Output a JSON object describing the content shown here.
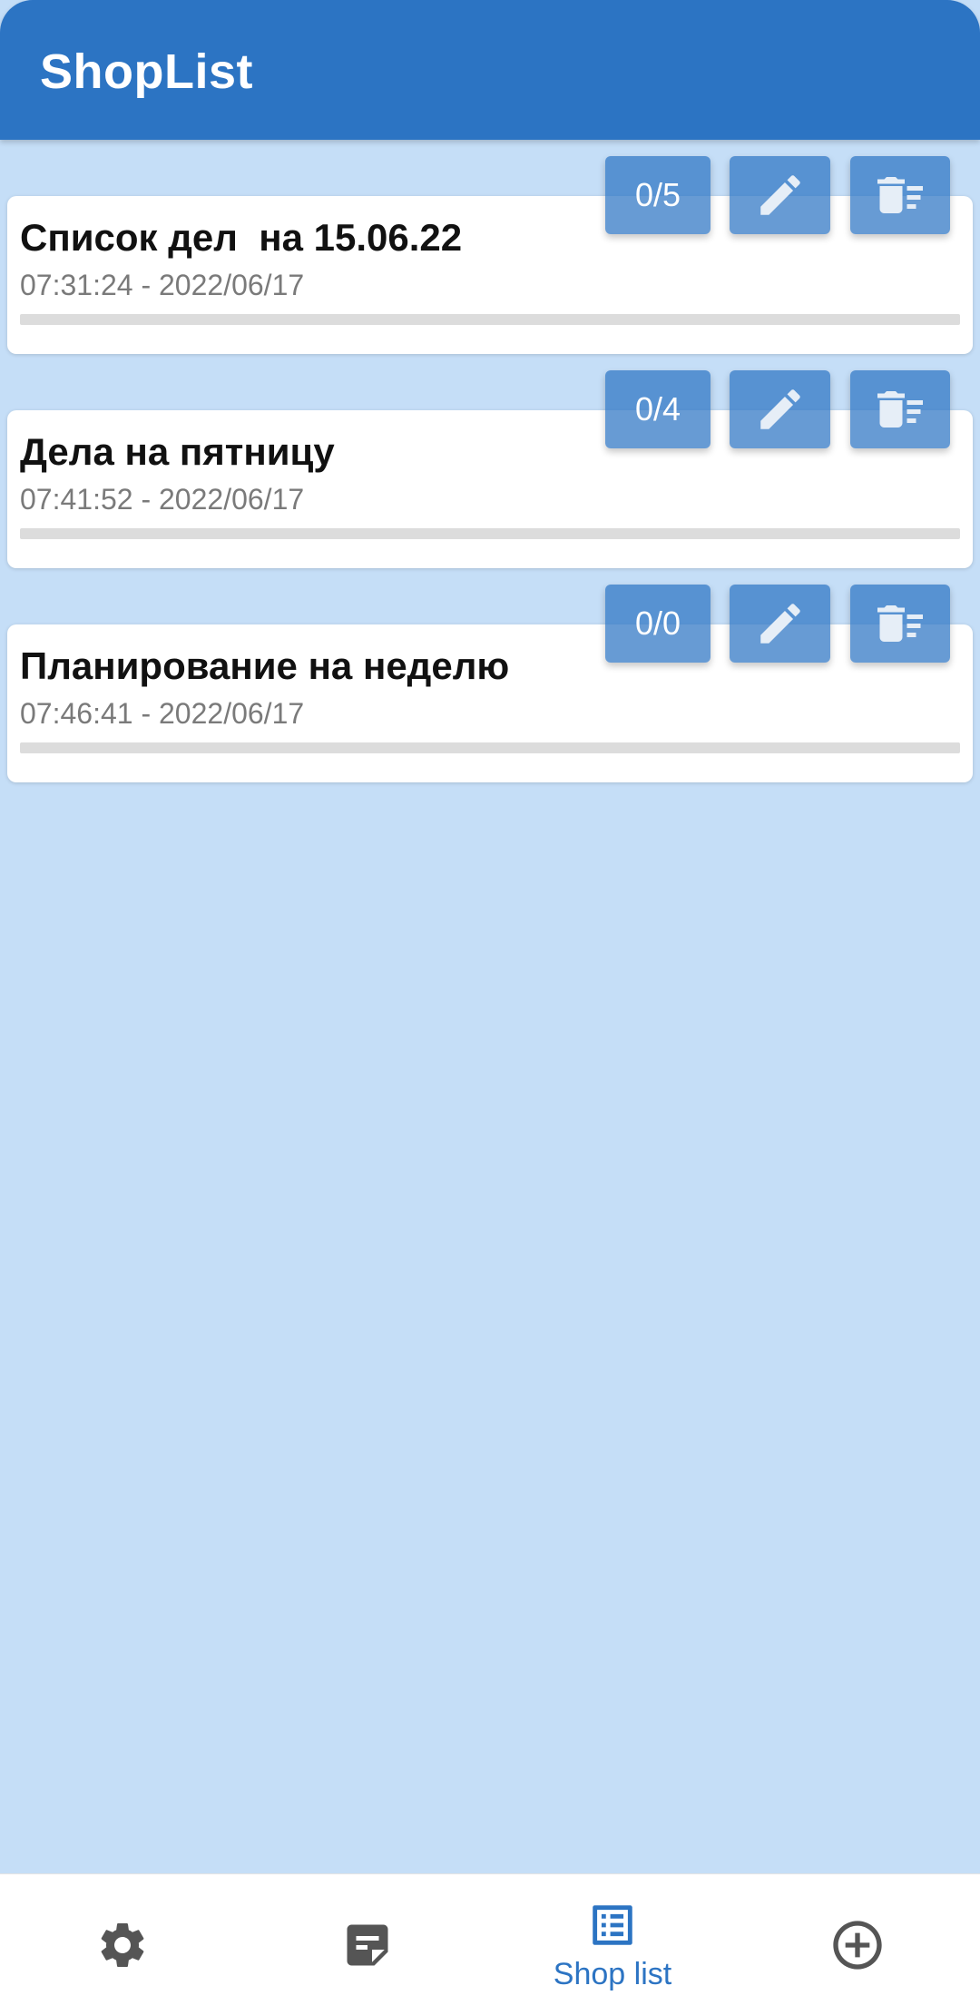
{
  "app_bar": {
    "title": "ShopList"
  },
  "lists": [
    {
      "title": "Список дел  на 15.06.22",
      "timestamp": "07:31:24 - 2022/06/17",
      "count": "0/5",
      "progress": 0
    },
    {
      "title": "Дела на пятницу",
      "timestamp": "07:41:52 - 2022/06/17",
      "count": "0/4",
      "progress": 0
    },
    {
      "title": "Планирование на неделю",
      "timestamp": "07:46:41 - 2022/06/17",
      "count": "0/0",
      "progress": 0
    }
  ],
  "item_actions": {
    "edit_icon": "pencil-icon",
    "delete_icon": "delete-sweep-icon"
  },
  "bottom_nav": {
    "items": [
      {
        "icon": "gear-icon",
        "label": "",
        "active": false
      },
      {
        "icon": "note-icon",
        "label": "",
        "active": false
      },
      {
        "icon": "list-icon",
        "label": "Shop list",
        "active": true
      },
      {
        "icon": "add-circle-icon",
        "label": "",
        "active": false
      }
    ]
  },
  "colors": {
    "primary": "#2c74c3",
    "background": "#c5def7",
    "card": "#ffffff",
    "inactive_icon": "#555555"
  }
}
